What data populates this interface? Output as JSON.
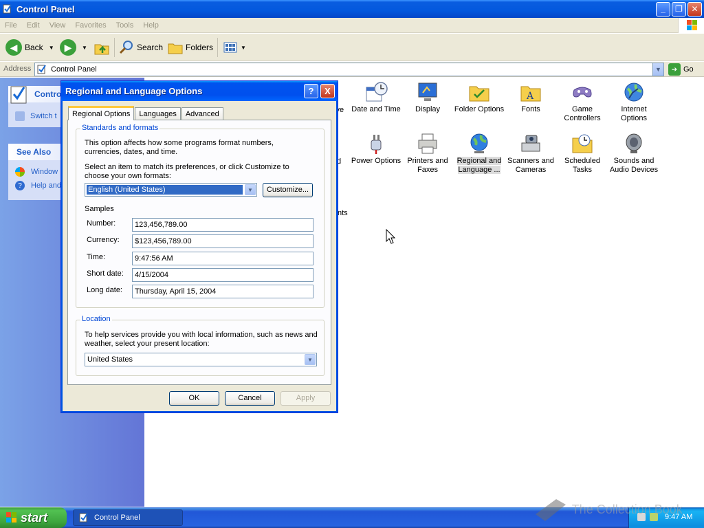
{
  "window": {
    "title": "Control Panel",
    "menu": [
      "File",
      "Edit",
      "View",
      "Favorites",
      "Tools",
      "Help"
    ],
    "toolbar": {
      "back": "Back",
      "search": "Search",
      "folders": "Folders"
    },
    "address": {
      "label": "Address",
      "value": "Control Panel",
      "go": "Go"
    }
  },
  "leftpane": {
    "cp_title": "Control",
    "switch_link": "Switch t",
    "see_also": "See Also",
    "links": [
      "Window",
      "Help and"
    ]
  },
  "content": {
    "partial": [
      "ive",
      "d",
      "nts"
    ],
    "icons": [
      {
        "label": "Date and Time"
      },
      {
        "label": "Display"
      },
      {
        "label": "Folder Options"
      },
      {
        "label": "Fonts"
      },
      {
        "label": "Game Controllers"
      },
      {
        "label": "Internet Options"
      },
      {
        "label": "Power Options"
      },
      {
        "label": "Printers and Faxes"
      },
      {
        "label": "Regional and Language ..."
      },
      {
        "label": "Scanners and Cameras"
      },
      {
        "label": "Scheduled Tasks"
      },
      {
        "label": "Sounds and Audio Devices"
      }
    ]
  },
  "dialog": {
    "title": "Regional and Language Options",
    "help": "?",
    "close": "X",
    "tabs": [
      "Regional Options",
      "Languages",
      "Advanced"
    ],
    "standards": {
      "legend": "Standards and formats",
      "desc": "This option affects how some programs format numbers, currencies, dates, and time.",
      "select_text": "Select an item to match its preferences, or click Customize to choose your own formats:",
      "selected_format": "English (United States)",
      "customize": "Customize...",
      "samples_label": "Samples",
      "samples": [
        {
          "label": "Number:",
          "value": "123,456,789.00"
        },
        {
          "label": "Currency:",
          "value": "$123,456,789.00"
        },
        {
          "label": "Time:",
          "value": "9:47:56 AM"
        },
        {
          "label": "Short date:",
          "value": "4/15/2004"
        },
        {
          "label": "Long date:",
          "value": "Thursday, April 15, 2004"
        }
      ]
    },
    "location": {
      "legend": "Location",
      "desc": "To help services provide you with local information, such as news and weather, select your present location:",
      "value": "United States"
    },
    "buttons": {
      "ok": "OK",
      "cancel": "Cancel",
      "apply": "Apply"
    }
  },
  "taskbar": {
    "start": "start",
    "task": "Control Panel",
    "clock": "9:47 AM"
  },
  "watermark": "The Collection Book"
}
